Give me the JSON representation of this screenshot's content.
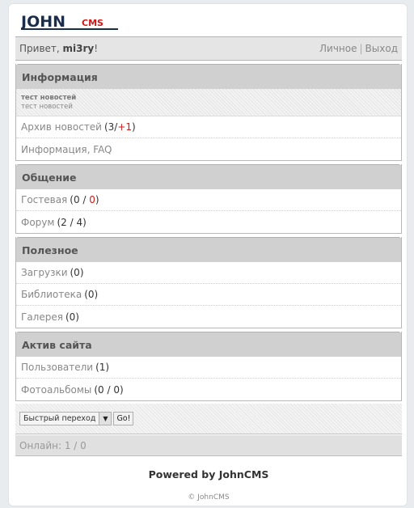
{
  "logo": {
    "text_main": "JOHN",
    "text_sub": "CMS",
    "main_color": "#1c2d4a",
    "sub_color": "#d01818"
  },
  "header": {
    "greeting": "Привет, ",
    "username": "mi3ry",
    "exclaim": "!",
    "personal_link": "Личное",
    "separator": "|",
    "logout_link": "Выход"
  },
  "sections": {
    "info": {
      "title": "Информация",
      "news_title": "тест новостей",
      "news_body": "тест новостей",
      "archive_label": "Архив новостей",
      "archive_open": "(3/",
      "archive_new": "+1",
      "archive_close": ")",
      "faq_label": "Информация, FAQ"
    },
    "social": {
      "title": "Общение",
      "guest_label": "Гостевая",
      "guest_open": "(0 / ",
      "guest_new": "0",
      "guest_close": ")",
      "forum_label": "Форум",
      "forum_count": "(2 / 4)"
    },
    "useful": {
      "title": "Полезное",
      "downloads_label": "Загрузки",
      "downloads_count": "(0)",
      "library_label": "Библиотека",
      "library_count": "(0)",
      "gallery_label": "Галерея",
      "gallery_count": "(0)"
    },
    "active": {
      "title": "Актив сайта",
      "users_label": "Пользователи",
      "users_count": "(1)",
      "albums_label": "Фотоальбомы",
      "albums_count": "(0 / 0)"
    }
  },
  "quick_jump": {
    "selected": "Быстрый переход",
    "go_label": "Go!"
  },
  "online": "Онлайн: 1 / 0",
  "powered": "Powered by JohnCMS",
  "copyright": "© JohnCMS",
  "colors": {
    "accent_red": "#d01818",
    "header_bg": "#d0d0d0"
  }
}
